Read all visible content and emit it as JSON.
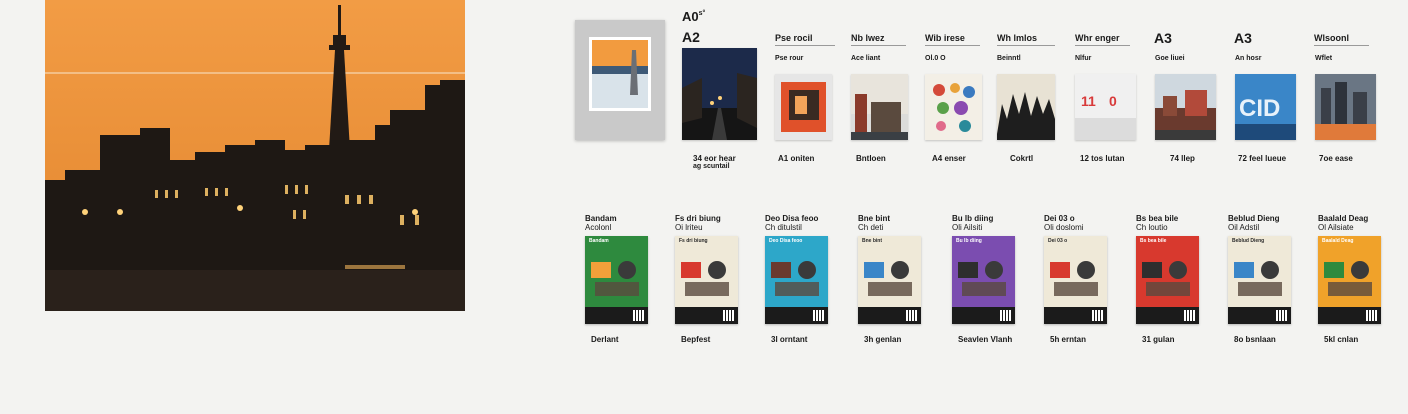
{
  "hero": {
    "sky_top": "#f4a04a",
    "sky_bottom": "#e88a2e",
    "lights": "#ffd27a"
  },
  "a0": {
    "label": "A0",
    "sup": "s°"
  },
  "a2": {
    "label": "A2"
  },
  "top_columns": [
    {
      "header": "Pse rocil",
      "sub": "Pse rour",
      "caption": "34 eor hear",
      "caption2": "ag scuntail"
    },
    {
      "header": "Nb lwez",
      "sub": "Ace liant",
      "caption": "A1 oniten"
    },
    {
      "header": "Wib irese",
      "sub": "Ol.0 O",
      "caption": "Bntloen"
    },
    {
      "header": "Wh lmlos",
      "sub": "Beinntl",
      "caption": "A4 enser"
    },
    {
      "header": "Whr enger",
      "sub": "Nlfur",
      "caption": "Cokrtl"
    },
    {
      "header": "A3",
      "sub": "Goe liuei",
      "caption": "12 tos lutan"
    },
    {
      "header": "A3",
      "sub": "An hosr",
      "caption": "74 llep"
    },
    {
      "header": "Wlsoonl",
      "sub": "Wflet",
      "caption": "72 feel lueue"
    },
    {
      "header": "",
      "sub": "",
      "caption": "7oe ease"
    }
  ],
  "posters": [
    {
      "t1": "Bandam",
      "t2": "Acolonl",
      "color": "#2e8a3e",
      "caption": "Derlant"
    },
    {
      "t1": "Fs dri biung",
      "t2": "Oi lriteu",
      "color": "#efe9d8",
      "caption": "Bepfest"
    },
    {
      "t1": "Deo Disa feoo",
      "t2": "Ch ditulstil",
      "color": "#2da7c9",
      "caption": "3l orntant"
    },
    {
      "t1": "Bne bint",
      "t2": "Ch deti",
      "color": "#efe9d8",
      "caption": "3h genlan"
    },
    {
      "t1": "Bu lb diing",
      "t2": "Oli Ailsiti",
      "color": "#7b4db0",
      "caption": "Seavlen Vlanh"
    },
    {
      "t1": "Dei 03 o",
      "t2": "Oli doslomi",
      "color": "#efe9d8",
      "caption": "5h erntan"
    },
    {
      "t1": "Bs bea bile",
      "t2": "Ch loutio",
      "color": "#d8392e",
      "caption": "31 gulan"
    },
    {
      "t1": "Beblud Dieng",
      "t2": "Oil Adstil",
      "color": "#efe9d8",
      "caption": "8o bsnlaan"
    },
    {
      "t1": "Baalald Deag",
      "t2": "Ol Ailsiate",
      "color": "#f0a22a",
      "caption": "5kl cnlan"
    }
  ]
}
